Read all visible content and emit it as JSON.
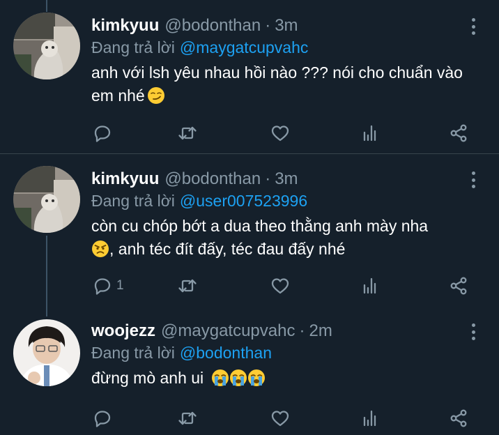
{
  "tweets": [
    {
      "display_name": "kimkyuu",
      "handle": "@bodonthan",
      "time": "3m",
      "reply_prefix": "Đang trả lời",
      "reply_to": "@maygatcupvahc",
      "text": "anh với lsh yêu nhau hồi nào ??? nói cho chuẩn vào em nhé",
      "emojis": [
        "smirking-face"
      ],
      "reply_count": ""
    },
    {
      "display_name": "kimkyuu",
      "handle": "@bodonthan",
      "time": "3m",
      "reply_prefix": "Đang trả lời",
      "reply_to": "@user007523996",
      "text_line1": "còn cu chóp bớt a dua theo thằng anh mày nha",
      "text_line2": ", anh téc đít đấy, téc đau đấy nhé",
      "emojis": [
        "angry-face"
      ],
      "reply_count": "1"
    },
    {
      "display_name": "woojezz",
      "handle": "@maygatcupvahc",
      "time": "2m",
      "reply_prefix": "Đang trả lời",
      "reply_to": "@bodonthan",
      "text": "đừng mò anh ui",
      "emojis": [
        "loudly-crying-face",
        "loudly-crying-face",
        "loudly-crying-face"
      ],
      "reply_count": ""
    }
  ],
  "separator": "·",
  "colors": {
    "background": "#15202b",
    "secondary_text": "#8899a6",
    "link": "#1da1f2",
    "divider": "#38444d"
  },
  "icons": [
    "reply-icon",
    "retweet-icon",
    "like-icon",
    "analytics-icon",
    "share-icon",
    "more-icon"
  ]
}
